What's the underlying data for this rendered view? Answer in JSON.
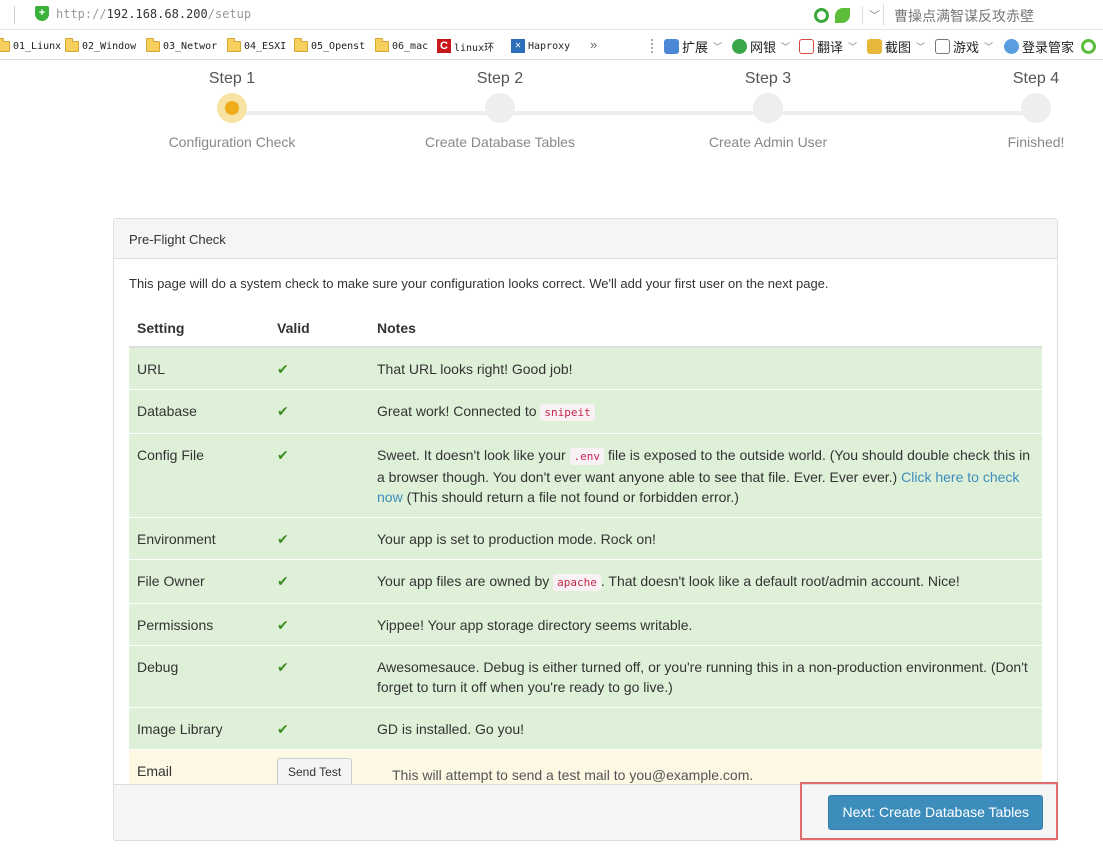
{
  "browser": {
    "url_scheme": "http://",
    "url_host": "192.168.68.200",
    "url_path": "/setup",
    "search_hint": "曹操点满智谋反攻赤壁",
    "bookmarks": [
      {
        "label": "01_Liunx",
        "icon": "folder-icon"
      },
      {
        "label": "02_Window",
        "icon": "folder-icon"
      },
      {
        "label": "03_Networ",
        "icon": "folder-icon"
      },
      {
        "label": "04_ESXI",
        "icon": "folder-icon"
      },
      {
        "label": "05_Openst",
        "icon": "folder-icon"
      },
      {
        "label": "06_mac",
        "icon": "folder-icon"
      },
      {
        "label": "linux环",
        "icon": "c-logo-icon"
      },
      {
        "label": "Haproxy",
        "icon": "haproxy-icon"
      }
    ],
    "more": "»",
    "tools": [
      {
        "label": "扩展",
        "icon": "extensions-icon"
      },
      {
        "label": "网银",
        "icon": "bank-icon"
      },
      {
        "label": "翻译",
        "icon": "translate-icon"
      },
      {
        "label": "截图",
        "icon": "screenshot-icon"
      },
      {
        "label": "游戏",
        "icon": "games-icon"
      },
      {
        "label": "登录管家",
        "icon": "login-manager-icon"
      }
    ]
  },
  "steps": [
    {
      "title": "Step 1",
      "label": "Configuration Check",
      "active": true
    },
    {
      "title": "Step 2",
      "label": "Create Database Tables",
      "active": false
    },
    {
      "title": "Step 3",
      "label": "Create Admin User",
      "active": false
    },
    {
      "title": "Step 4",
      "label": "Finished!",
      "active": false
    }
  ],
  "panel": {
    "heading": "Pre-Flight Check",
    "intro": "This page will do a system check to make sure your configuration looks correct. We'll add your first user on the next page.",
    "columns": [
      "Setting",
      "Valid",
      "Notes"
    ],
    "rows": {
      "url": {
        "setting": "URL",
        "note": "That URL looks right! Good job!"
      },
      "database": {
        "setting": "Database",
        "note": "Great work! Connected to ",
        "code": "snipeit"
      },
      "config": {
        "setting": "Config File",
        "note_a": "Sweet. It doesn't look like your ",
        "code": ".env",
        "note_b": " file is exposed to the outside world. (You should double check this in a browser though. You don't ever want anyone able to see that file. Ever. Ever ever.) ",
        "link": "Click here to check now",
        "note_c": " (This should return a file not found or forbidden error.)"
      },
      "environment": {
        "setting": "Environment",
        "note": "Your app is set to production mode. Rock on!"
      },
      "owner": {
        "setting": "File Owner",
        "note_a": "Your app files are owned by ",
        "code": "apache",
        "note_b": ". That doesn't look like a default root/admin account. Nice!"
      },
      "permissions": {
        "setting": "Permissions",
        "note": "Yippee! Your app storage directory seems writable."
      },
      "debug": {
        "setting": "Debug",
        "note": "Awesomesauce. Debug is either turned off, or you're running this in a non-production environment. (Don't forget to turn it off when you're ready to go live.)"
      },
      "image": {
        "setting": "Image Library",
        "note": "GD is installed. Go you!"
      },
      "email": {
        "setting": "Email",
        "button": "Send Test",
        "note": "This will attempt to send a test mail to you@example.com."
      }
    },
    "check_mark": "✔",
    "next_button": "Next: Create Database Tables"
  },
  "colors": {
    "success_row": "#dff0d8",
    "warning_row": "#fcf8e3",
    "primary": "#3c8dbc",
    "active_step": "#f0ad19",
    "highlight": "#e46b6b"
  }
}
